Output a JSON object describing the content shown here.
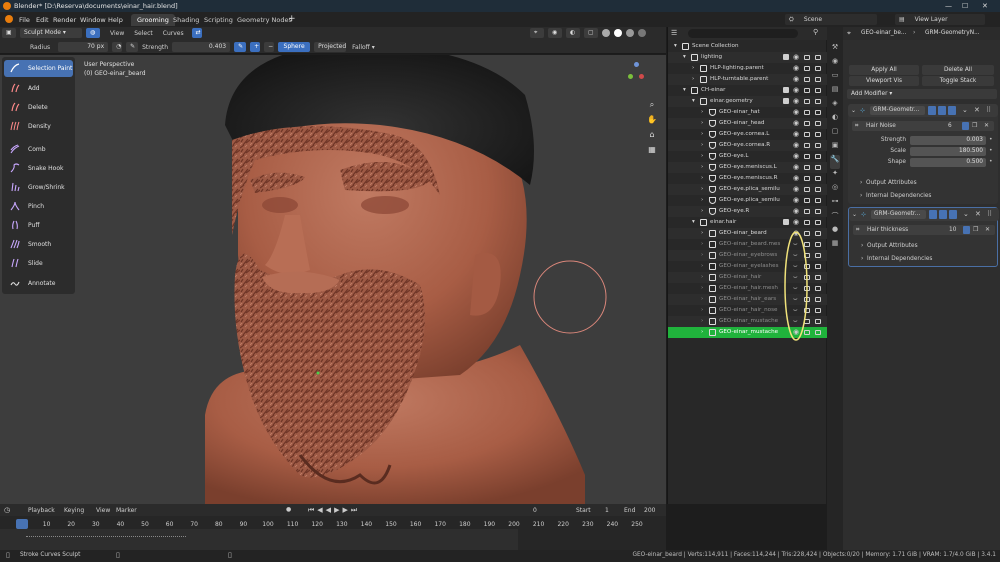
{
  "window": {
    "title": "Blender* [D:\\Reserva\\documents\\einar_hair.blend]"
  },
  "menus": [
    "File",
    "Edit",
    "Render",
    "Window",
    "Help"
  ],
  "workspaces": [
    "Grooming",
    "Shading",
    "Scripting",
    "Geometry Nodes"
  ],
  "topbar_right": {
    "scene": "Scene",
    "view_layer": "View Layer"
  },
  "viewport_header": {
    "mode": "Sculpt Mode",
    "menus": [
      "View",
      "Select",
      "Curves"
    ],
    "radius_label": "Radius",
    "radius_value": "70 px",
    "strength_label": "Strength",
    "strength_value": "0.403",
    "falloff_shape": "Sphere",
    "projected": "Projected",
    "falloff": "Falloff"
  },
  "viewport_info": {
    "line1": "User Perspective",
    "line2": "(0) GEO-einar_beard"
  },
  "tools": [
    {
      "label": "Selection Paint",
      "icon": "selection-paint-icon",
      "active": true
    },
    {
      "label": "Add",
      "icon": "add-curve-icon"
    },
    {
      "label": "Delete",
      "icon": "delete-curve-icon"
    },
    {
      "label": "Density",
      "icon": "density-icon"
    },
    {
      "label": "Comb",
      "icon": "comb-icon"
    },
    {
      "label": "Snake Hook",
      "icon": "snake-hook-icon"
    },
    {
      "label": "Grow/Shrink",
      "icon": "grow-shrink-icon"
    },
    {
      "label": "Pinch",
      "icon": "pinch-icon"
    },
    {
      "label": "Puff",
      "icon": "puff-icon"
    },
    {
      "label": "Smooth",
      "icon": "smooth-icon"
    },
    {
      "label": "Slide",
      "icon": "slide-icon"
    },
    {
      "label": "Annotate",
      "icon": "annotate-icon"
    }
  ],
  "outliner": {
    "rows": [
      {
        "name": "Scene Collection",
        "depth": 0,
        "type": "scene"
      },
      {
        "name": "lighting",
        "depth": 1,
        "type": "collection"
      },
      {
        "name": "HLP-lighting.parent",
        "depth": 2,
        "type": "empty"
      },
      {
        "name": "HLP-turntable.parent",
        "depth": 2,
        "type": "empty"
      },
      {
        "name": "CH-einar",
        "depth": 1,
        "type": "collection"
      },
      {
        "name": "einar.geometry",
        "depth": 2,
        "type": "collection"
      },
      {
        "name": "GEO-einar_hat",
        "depth": 3,
        "type": "mesh"
      },
      {
        "name": "GEO-einar_head",
        "depth": 3,
        "type": "mesh"
      },
      {
        "name": "GEO-eye.cornea.L",
        "depth": 3,
        "type": "mesh"
      },
      {
        "name": "GEO-eye.cornea.R",
        "depth": 3,
        "type": "mesh"
      },
      {
        "name": "GEO-eye.L",
        "depth": 3,
        "type": "mesh"
      },
      {
        "name": "GEO-eye.meniscus.L",
        "depth": 3,
        "type": "mesh"
      },
      {
        "name": "GEO-eye.meniscus.R",
        "depth": 3,
        "type": "mesh"
      },
      {
        "name": "GEO-eye.plica_semilu",
        "depth": 3,
        "type": "mesh"
      },
      {
        "name": "GEO-eye.plica_semilu",
        "depth": 3,
        "type": "mesh"
      },
      {
        "name": "GEO-eye.R",
        "depth": 3,
        "type": "mesh"
      },
      {
        "name": "einar.hair",
        "depth": 2,
        "type": "collection"
      },
      {
        "name": "GEO-einar_beard",
        "depth": 3,
        "type": "curves"
      },
      {
        "name": "GEO-einar_beard.mes",
        "depth": 3,
        "type": "curves",
        "dim": true
      },
      {
        "name": "GEO-einar_eyebrows",
        "depth": 3,
        "type": "curves",
        "dim": true
      },
      {
        "name": "GEO-einar_eyelashes",
        "depth": 3,
        "type": "curves",
        "dim": true
      },
      {
        "name": "GEO-einar_hair",
        "depth": 3,
        "type": "curves",
        "dim": true
      },
      {
        "name": "GEO-einar_hair.mesh",
        "depth": 3,
        "type": "curves",
        "dim": true
      },
      {
        "name": "GEO-einar_hair_ears",
        "depth": 3,
        "type": "curves",
        "dim": true
      },
      {
        "name": "GEO-einar_hair_nose",
        "depth": 3,
        "type": "curves",
        "dim": true
      },
      {
        "name": "GEO-einar_mustache",
        "depth": 3,
        "type": "curves",
        "dim": true
      },
      {
        "name": "GEO-einar_mustache",
        "depth": 3,
        "type": "curves",
        "selected": true
      }
    ]
  },
  "properties": {
    "object_name": "GEO-einar_be...",
    "modifier_name": "GRM-GeometryN...",
    "apply_all": "Apply All",
    "delete_all": "Delete All",
    "viewport_vis": "Viewport Vis",
    "toggle_stack": "Toggle Stack",
    "add_modifier": "Add Modifier",
    "modifiers": [
      {
        "name": "GRM-Geometr...",
        "node_group": "Hair Noise",
        "users": "6",
        "fields": [
          {
            "label": "Strength",
            "value": "0.003",
            "fill": 0.01
          },
          {
            "label": "Scale",
            "value": "180.500",
            "fill": 0.5
          },
          {
            "label": "Shape",
            "value": "0.500",
            "fill": 0.5
          }
        ],
        "sections": [
          "Output Attributes",
          "Internal Dependencies"
        ]
      },
      {
        "name": "GRM-Geometr...",
        "node_group": "Hair thickness",
        "users": "10",
        "fields": [],
        "sections": [
          "Output Attributes",
          "Internal Dependencies"
        ]
      }
    ]
  },
  "timeline": {
    "menus": [
      "Playback",
      "Keying",
      "View",
      "Marker"
    ],
    "current_frame": "0",
    "start_label": "Start",
    "start": "1",
    "end_label": "End",
    "end": "200",
    "frames": [
      "0",
      "10",
      "20",
      "30",
      "40",
      "50",
      "60",
      "70",
      "80",
      "90",
      "100",
      "110",
      "120",
      "130",
      "140",
      "150",
      "160",
      "170",
      "180",
      "190",
      "200",
      "210",
      "220",
      "230",
      "240",
      "250"
    ]
  },
  "status": {
    "left": "Stroke Curves Sculpt",
    "right": "GEO-einar_beard | Verts:114,911 | Faces:114,244 | Tris:228,424 | Objects:0/20 | Memory: 1.71 GiB | VRAM: 1.7/4.0 GiB | 3.4.1"
  },
  "colors": {
    "accent_blue": "#4772b3",
    "selection_green": "#20b33c",
    "skin": "#b4674f",
    "hat": "#242424"
  }
}
